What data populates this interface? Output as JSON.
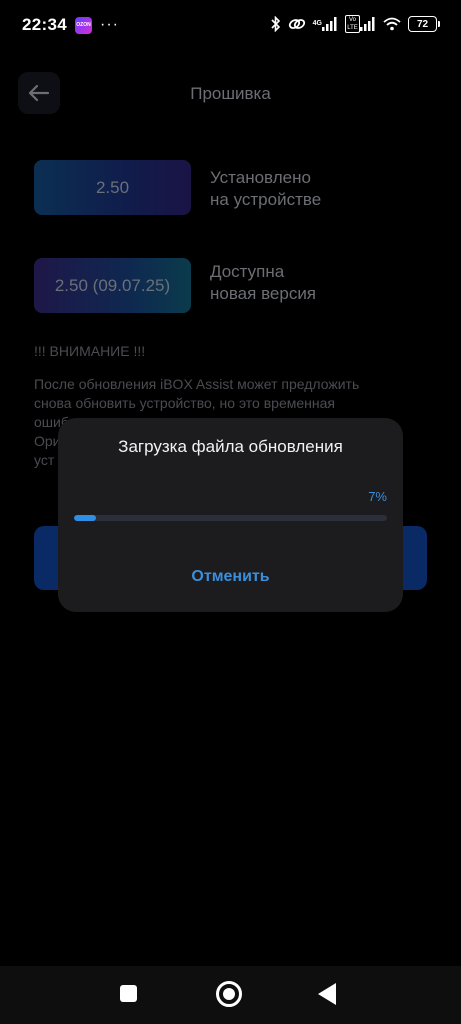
{
  "status_bar": {
    "time": "22:34",
    "app_badge": "OZON",
    "more_indicator": "···",
    "network_label": "4G",
    "volte_label": "Vo LTE",
    "battery_level": "72",
    "icons": [
      "bluetooth-icon",
      "link-icon",
      "signal-icon",
      "signal-icon",
      "wifi-icon",
      "battery-icon"
    ]
  },
  "header": {
    "title": "Прошивка",
    "back_icon": "arrow-left-icon"
  },
  "firmware": {
    "installed_version": "2.50",
    "installed_label_line1": "Установлено",
    "installed_label_line2": "на устройстве",
    "available_version": "2.50 (09.07.25)",
    "available_label_line1": "Доступна",
    "available_label_line2": "новая версия"
  },
  "warning": {
    "title": "!!! ВНИМАНИЕ !!!",
    "line1": "После обновления iBOX Assist может предложить",
    "line2": "снова обновить устройство, но это временная",
    "line3": "ошиб",
    "line4": "Ори",
    "line5": "уст"
  },
  "dialog": {
    "title": "Загрузка файла обновления",
    "percent_text": "7%",
    "progress_fraction": 0.07,
    "cancel_label": "Отменить"
  },
  "colors": {
    "accent": "#2f8fe6",
    "dialog_bg": "#1c1c1e"
  },
  "nav_bar": {
    "icons": [
      "recents-square-icon",
      "home-circle-icon",
      "back-triangle-icon"
    ]
  }
}
